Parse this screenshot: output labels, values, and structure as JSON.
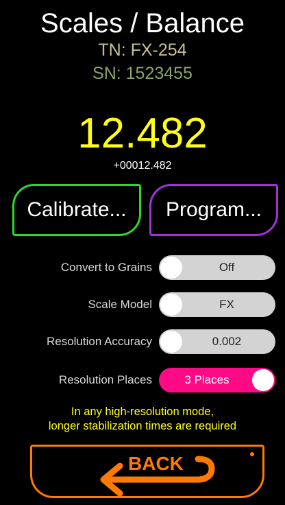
{
  "header": {
    "title": "Scales / Balance",
    "tn": "TN: FX-254",
    "sn": "SN: 1523455"
  },
  "reading": {
    "value": "12.482",
    "raw": "+00012.482"
  },
  "buttons": {
    "calibrate": "Calibrate...",
    "program": "Program..."
  },
  "settings": [
    {
      "label": "Convert to Grains",
      "value": "Off",
      "on": false
    },
    {
      "label": "Scale Model",
      "value": "FX",
      "on": false
    },
    {
      "label": "Resolution Accuracy",
      "value": "0.002",
      "on": false
    },
    {
      "label": "Resolution Places",
      "value": "3 Places",
      "on": true
    }
  ],
  "note": {
    "line1": "In any high-resolution mode,",
    "line2": "longer stabilization times are required"
  },
  "back": {
    "label": "BACK",
    "icon": "back-arrow-icon"
  },
  "colors": {
    "title": "#ffffff",
    "tn": "#c9bf95",
    "sn": "#8aa56a",
    "reading": "#ffff1a",
    "calibrate_border": "#2fd82f",
    "program_border": "#a033d6",
    "toggle_on": "#ff0a86",
    "toggle_off": "#d3d3d3",
    "back": "#ff7a00"
  }
}
